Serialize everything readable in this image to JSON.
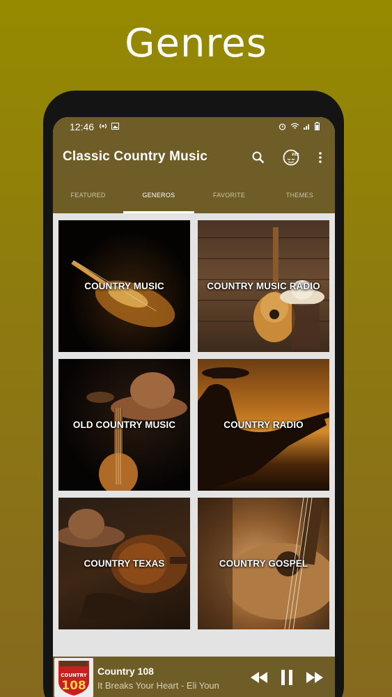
{
  "promo": {
    "title": "Genres"
  },
  "status_bar": {
    "time": "12:46"
  },
  "toolbar": {
    "title": "Classic Country Music",
    "icons": [
      "search-icon",
      "sleep-timer-icon",
      "more-vert-icon"
    ]
  },
  "tabs": [
    {
      "label": "FEATURED",
      "active": false
    },
    {
      "label": "GENEROS",
      "active": true
    },
    {
      "label": "FAVORITE",
      "active": false
    },
    {
      "label": "THEMES",
      "active": false
    }
  ],
  "genres": [
    {
      "label": "COUNTRY MUSIC"
    },
    {
      "label": "COUNTRY MUSIC RADIO"
    },
    {
      "label": "OLD COUNTRY MUSIC"
    },
    {
      "label": "COUNTRY RADIO"
    },
    {
      "label": "COUNTRY TEXAS"
    },
    {
      "label": "COUNTRY GOSPEL"
    }
  ],
  "player": {
    "station": "Country 108",
    "song": "It Breaks Your Heart - Eli Youn",
    "logo_text": "COUNTRY",
    "logo_number": "108",
    "controls": [
      "rewind-icon",
      "pause-icon",
      "fast-forward-icon"
    ]
  },
  "colors": {
    "background": "#958a00",
    "app_bar": "#6f5d28",
    "phone_frame": "#141414",
    "grid_background": "#e3e3e3",
    "accent_tab": "#ffffff"
  }
}
